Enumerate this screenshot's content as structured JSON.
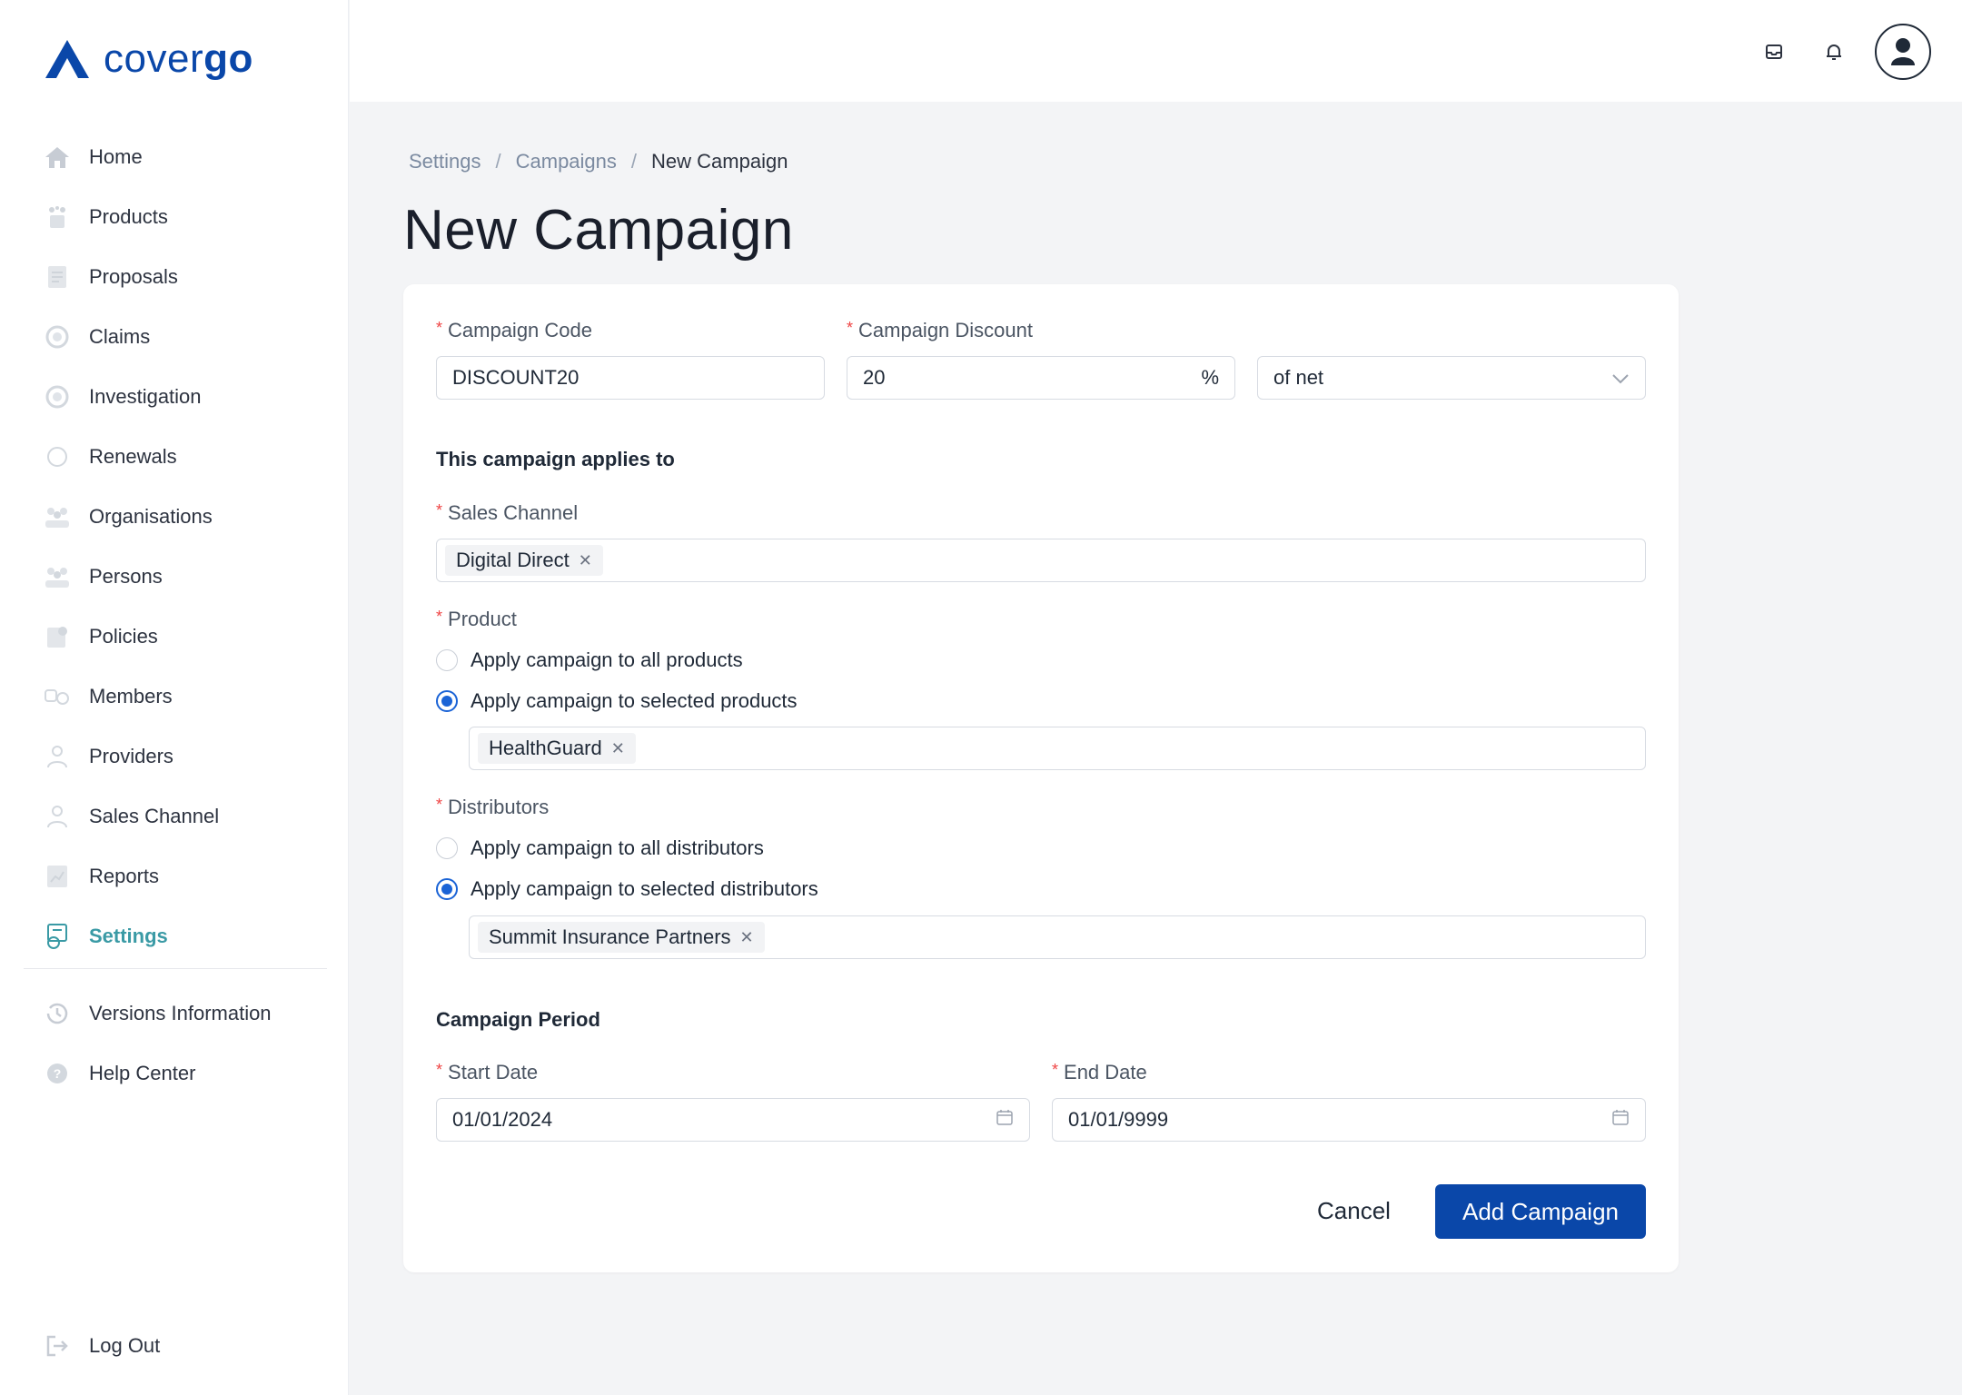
{
  "brand": {
    "name_light": "cover",
    "name_bold": "go",
    "color": "#0a47a9"
  },
  "sidebar": {
    "items": [
      {
        "label": "Home",
        "icon": "home-icon"
      },
      {
        "label": "Products",
        "icon": "products-icon"
      },
      {
        "label": "Proposals",
        "icon": "proposals-icon"
      },
      {
        "label": "Claims",
        "icon": "claims-icon"
      },
      {
        "label": "Investigation",
        "icon": "investigation-icon"
      },
      {
        "label": "Renewals",
        "icon": "renewals-icon"
      },
      {
        "label": "Organisations",
        "icon": "organisations-icon"
      },
      {
        "label": "Persons",
        "icon": "persons-icon"
      },
      {
        "label": "Policies",
        "icon": "policies-icon"
      },
      {
        "label": "Members",
        "icon": "members-icon"
      },
      {
        "label": "Providers",
        "icon": "providers-icon"
      },
      {
        "label": "Sales Channel",
        "icon": "sales-channel-icon"
      },
      {
        "label": "Reports",
        "icon": "reports-icon"
      },
      {
        "label": "Settings",
        "icon": "settings-icon",
        "active": true
      }
    ],
    "secondary": [
      {
        "label": "Versions Information",
        "icon": "history-icon"
      },
      {
        "label": "Help Center",
        "icon": "help-icon"
      }
    ],
    "logout": "Log Out",
    "active_color": "#3a9aa5"
  },
  "topbar": {
    "icons": [
      "inbox-icon",
      "bell-icon",
      "user-avatar-icon"
    ]
  },
  "breadcrumb": {
    "items": [
      "Settings",
      "Campaigns"
    ],
    "current": "New Campaign",
    "separator": "/"
  },
  "page": {
    "title": "New Campaign"
  },
  "form": {
    "campaign_code": {
      "label": "Campaign Code",
      "value": "DISCOUNT20"
    },
    "campaign_discount": {
      "label": "Campaign Discount",
      "value": "20",
      "suffix": "%",
      "basis": "of net"
    },
    "applies_heading": "This campaign applies to",
    "sales_channel": {
      "label": "Sales Channel",
      "tags": [
        "Digital Direct"
      ]
    },
    "product": {
      "label": "Product",
      "options": [
        "Apply campaign to all products",
        "Apply campaign to selected products"
      ],
      "selected": 1,
      "tags": [
        "HealthGuard"
      ]
    },
    "distributors": {
      "label": "Distributors",
      "options": [
        "Apply campaign to all distributors",
        "Apply campaign to selected distributors"
      ],
      "selected": 1,
      "tags": [
        "Summit Insurance Partners"
      ]
    },
    "period_heading": "Campaign Period",
    "start_date": {
      "label": "Start Date",
      "value": "01/01/2024"
    },
    "end_date": {
      "label": "End Date",
      "value": "01/01/9999"
    },
    "cancel_label": "Cancel",
    "submit_label": "Add Campaign",
    "primary_color": "#0a47a9",
    "radio_color": "#1a63d6",
    "required_color": "#ef4444"
  }
}
